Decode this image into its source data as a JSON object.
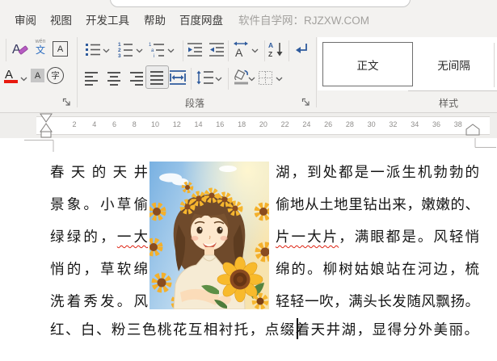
{
  "chrome": {
    "menu_items": [
      "审阅",
      "视图",
      "开发工具",
      "帮助",
      "百度网盘"
    ],
    "brand_text": "软件自学网：RJZXW.COM"
  },
  "ribbon": {
    "paragraph_group_label": "段落",
    "styles_group_label": "样式",
    "style_gallery": [
      {
        "label": "正文",
        "selected": true
      },
      {
        "label": "无间隔",
        "selected": false
      }
    ],
    "font_tool_glyphs": {
      "clear_format": "A",
      "pinyin_top": "wén",
      "pinyin_bottom": "文",
      "char_border": "A",
      "font_color": "A",
      "char_shading": "A",
      "enclose": "字"
    }
  },
  "ruler": {
    "numbers": [
      "2",
      "4",
      "6",
      "8",
      "10",
      "12",
      "14",
      "16",
      "18",
      "20",
      "22",
      "24",
      "26",
      "28",
      "30",
      "32",
      "34",
      "36",
      "38"
    ]
  },
  "document": {
    "left_column_lines": [
      {
        "pre": "春天的天井",
        "err": "",
        "post": ""
      },
      {
        "pre": "景象。小草偷",
        "err": "",
        "post": ""
      },
      {
        "pre": "绿绿的，",
        "err": "一大",
        "post": ""
      },
      {
        "pre": "悄的，草软绵",
        "err": "",
        "post": ""
      },
      {
        "pre": "洗着秀发。风",
        "err": "",
        "post": ""
      }
    ],
    "right_column_lines": [
      {
        "pre": "湖，到处都是一派生机勃勃的",
        "err": "",
        "post": ""
      },
      {
        "pre": "偷地从土地里钻出来，嫩嫩的、",
        "err": "",
        "post": ""
      },
      {
        "pre": "",
        "err": "片一大片",
        "post": "，满眼都是。风轻悄"
      },
      {
        "pre": "绵的。柳树姑娘站在河边，梳",
        "err": "",
        "post": ""
      },
      {
        "pre": "轻轻一吹，满头长发随风飘扬。",
        "err": "",
        "post": ""
      }
    ],
    "bottom_line": "红、白、粉三色桃花互相衬托，点缀着天井湖，显得分外美丽。",
    "image_description": "illustration of a smiling girl with brown hair wearing a sunflower crown, holding sunflowers in a sunflower field under a blue sky"
  },
  "icons": [
    "search-box",
    "clear-format-icon",
    "pinyin-guide-icon",
    "character-border-icon",
    "font-color-icon",
    "character-shading-icon",
    "enclose-character-icon",
    "bullets-icon",
    "numbering-icon",
    "multilevel-list-icon",
    "decrease-indent-icon",
    "increase-indent-icon",
    "asian-layout-icon",
    "sort-icon",
    "show-marks-icon",
    "align-left-icon",
    "align-center-icon",
    "align-right-icon",
    "justify-icon",
    "distribute-icon",
    "line-spacing-icon",
    "shading-icon",
    "borders-icon",
    "chevron-down-icon",
    "dialog-launcher-icon",
    "first-line-indent-marker",
    "hanging-indent-marker",
    "left-indent-marker",
    "right-indent-marker",
    "text-cursor"
  ],
  "colors": {
    "accent_blue": "#2f5b9d",
    "font_color_red": "#e8190e",
    "spellcheck_red": "#dd2211",
    "selected_style_border": "#6e6e6e",
    "chrome_bg": "#f3f2f0"
  }
}
